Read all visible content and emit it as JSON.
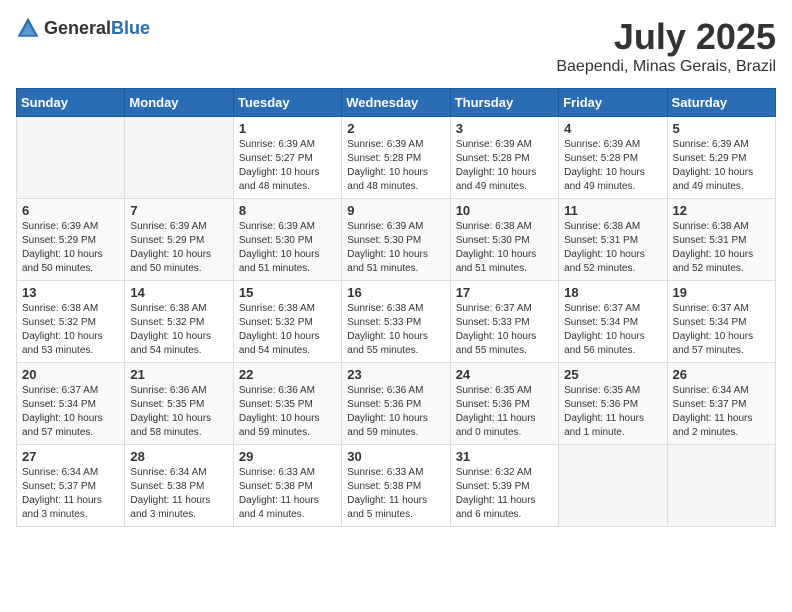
{
  "header": {
    "logo_general": "General",
    "logo_blue": "Blue",
    "title": "July 2025",
    "location": "Baependi, Minas Gerais, Brazil"
  },
  "weekdays": [
    "Sunday",
    "Monday",
    "Tuesday",
    "Wednesday",
    "Thursday",
    "Friday",
    "Saturday"
  ],
  "weeks": [
    [
      {
        "day": "",
        "info": ""
      },
      {
        "day": "",
        "info": ""
      },
      {
        "day": "1",
        "info": "Sunrise: 6:39 AM\nSunset: 5:27 PM\nDaylight: 10 hours and 48 minutes."
      },
      {
        "day": "2",
        "info": "Sunrise: 6:39 AM\nSunset: 5:28 PM\nDaylight: 10 hours and 48 minutes."
      },
      {
        "day": "3",
        "info": "Sunrise: 6:39 AM\nSunset: 5:28 PM\nDaylight: 10 hours and 49 minutes."
      },
      {
        "day": "4",
        "info": "Sunrise: 6:39 AM\nSunset: 5:28 PM\nDaylight: 10 hours and 49 minutes."
      },
      {
        "day": "5",
        "info": "Sunrise: 6:39 AM\nSunset: 5:29 PM\nDaylight: 10 hours and 49 minutes."
      }
    ],
    [
      {
        "day": "6",
        "info": "Sunrise: 6:39 AM\nSunset: 5:29 PM\nDaylight: 10 hours and 50 minutes."
      },
      {
        "day": "7",
        "info": "Sunrise: 6:39 AM\nSunset: 5:29 PM\nDaylight: 10 hours and 50 minutes."
      },
      {
        "day": "8",
        "info": "Sunrise: 6:39 AM\nSunset: 5:30 PM\nDaylight: 10 hours and 51 minutes."
      },
      {
        "day": "9",
        "info": "Sunrise: 6:39 AM\nSunset: 5:30 PM\nDaylight: 10 hours and 51 minutes."
      },
      {
        "day": "10",
        "info": "Sunrise: 6:38 AM\nSunset: 5:30 PM\nDaylight: 10 hours and 51 minutes."
      },
      {
        "day": "11",
        "info": "Sunrise: 6:38 AM\nSunset: 5:31 PM\nDaylight: 10 hours and 52 minutes."
      },
      {
        "day": "12",
        "info": "Sunrise: 6:38 AM\nSunset: 5:31 PM\nDaylight: 10 hours and 52 minutes."
      }
    ],
    [
      {
        "day": "13",
        "info": "Sunrise: 6:38 AM\nSunset: 5:32 PM\nDaylight: 10 hours and 53 minutes."
      },
      {
        "day": "14",
        "info": "Sunrise: 6:38 AM\nSunset: 5:32 PM\nDaylight: 10 hours and 54 minutes."
      },
      {
        "day": "15",
        "info": "Sunrise: 6:38 AM\nSunset: 5:32 PM\nDaylight: 10 hours and 54 minutes."
      },
      {
        "day": "16",
        "info": "Sunrise: 6:38 AM\nSunset: 5:33 PM\nDaylight: 10 hours and 55 minutes."
      },
      {
        "day": "17",
        "info": "Sunrise: 6:37 AM\nSunset: 5:33 PM\nDaylight: 10 hours and 55 minutes."
      },
      {
        "day": "18",
        "info": "Sunrise: 6:37 AM\nSunset: 5:34 PM\nDaylight: 10 hours and 56 minutes."
      },
      {
        "day": "19",
        "info": "Sunrise: 6:37 AM\nSunset: 5:34 PM\nDaylight: 10 hours and 57 minutes."
      }
    ],
    [
      {
        "day": "20",
        "info": "Sunrise: 6:37 AM\nSunset: 5:34 PM\nDaylight: 10 hours and 57 minutes."
      },
      {
        "day": "21",
        "info": "Sunrise: 6:36 AM\nSunset: 5:35 PM\nDaylight: 10 hours and 58 minutes."
      },
      {
        "day": "22",
        "info": "Sunrise: 6:36 AM\nSunset: 5:35 PM\nDaylight: 10 hours and 59 minutes."
      },
      {
        "day": "23",
        "info": "Sunrise: 6:36 AM\nSunset: 5:36 PM\nDaylight: 10 hours and 59 minutes."
      },
      {
        "day": "24",
        "info": "Sunrise: 6:35 AM\nSunset: 5:36 PM\nDaylight: 11 hours and 0 minutes."
      },
      {
        "day": "25",
        "info": "Sunrise: 6:35 AM\nSunset: 5:36 PM\nDaylight: 11 hours and 1 minute."
      },
      {
        "day": "26",
        "info": "Sunrise: 6:34 AM\nSunset: 5:37 PM\nDaylight: 11 hours and 2 minutes."
      }
    ],
    [
      {
        "day": "27",
        "info": "Sunrise: 6:34 AM\nSunset: 5:37 PM\nDaylight: 11 hours and 3 minutes."
      },
      {
        "day": "28",
        "info": "Sunrise: 6:34 AM\nSunset: 5:38 PM\nDaylight: 11 hours and 3 minutes."
      },
      {
        "day": "29",
        "info": "Sunrise: 6:33 AM\nSunset: 5:38 PM\nDaylight: 11 hours and 4 minutes."
      },
      {
        "day": "30",
        "info": "Sunrise: 6:33 AM\nSunset: 5:38 PM\nDaylight: 11 hours and 5 minutes."
      },
      {
        "day": "31",
        "info": "Sunrise: 6:32 AM\nSunset: 5:39 PM\nDaylight: 11 hours and 6 minutes."
      },
      {
        "day": "",
        "info": ""
      },
      {
        "day": "",
        "info": ""
      }
    ]
  ]
}
